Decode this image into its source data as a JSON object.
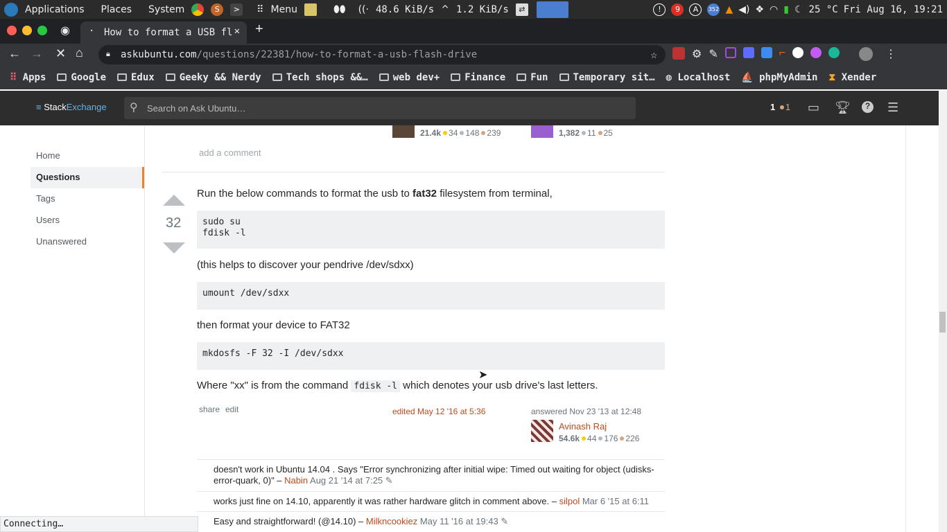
{
  "os_panel": {
    "menu_applications": "Applications",
    "menu_places": "Places",
    "menu_system": "System",
    "menu_menu": "Menu",
    "net_down": "48.6 KiB/s",
    "net_up": "1.2 KiB/s",
    "badge_9": "9",
    "badge_a": "A",
    "badge_352": "352",
    "temperature": "25 °C",
    "datetime": "Fri Aug 16, 19:21"
  },
  "browser": {
    "tab_title": "How to format a USB fl",
    "url_domain": "askubuntu.com",
    "url_path": "/questions/22381/how-to-format-a-usb-flash-drive",
    "bookmarks": [
      "Apps",
      "Google",
      "Edux",
      "Geeky && Nerdy",
      "Tech shops &&…",
      "web dev+",
      "Finance",
      "Fun",
      "Temporary sit…",
      "Localhost",
      "phpMyAdmin",
      "Xender"
    ],
    "status_text": "Connecting…"
  },
  "stackexchange": {
    "brand_stack": "Stack",
    "brand_exchange": "Exchange",
    "search_placeholder": "Search on Ask Ubuntu…",
    "rep": "1",
    "bronze_count": "1"
  },
  "left_nav": {
    "items": [
      "Home",
      "Questions",
      "Tags",
      "Users",
      "Unanswered"
    ]
  },
  "top_user_cards": {
    "card1": {
      "rep": "21.4k",
      "gold": "34",
      "silver": "148",
      "bronze": "239"
    },
    "card2": {
      "rep": "1,382",
      "silver": "11",
      "bronze": "25"
    },
    "add_comment": "add a comment"
  },
  "answer": {
    "votes": "32",
    "p1_before": "Run the below commands to format the usb to ",
    "p1_bold": "fat32",
    "p1_after": " filesystem from terminal,",
    "code1": "sudo su\nfdisk -l",
    "p2": "(this helps to discover your pendrive /dev/sdxx)",
    "code2": "umount /dev/sdxx",
    "p3": "then format your device to FAT32",
    "code3": "mkdosfs -F 32 -I /dev/sdxx",
    "p4_before": "Where \"xx\" is from the command ",
    "p4_code": "fdisk -l",
    "p4_after": " which denotes your usb drive's last letters.",
    "share": "share",
    "edit": "edit",
    "edited": "edited May 12 '16 at 5:36",
    "answered": "answered Nov 23 '13 at 12:48",
    "author": "Avinash Raj",
    "author_rep": "54.6k",
    "author_gold": "44",
    "author_silver": "176",
    "author_bronze": "226"
  },
  "comments": [
    {
      "text": "doesn't work in Ubuntu 14.04 . Says \"Error synchronizing after initial wipe: Timed out waiting for object (udisks-error-quark, 0)\" – ",
      "user": "Nabin",
      "date": "Aug 21 '14 at 7:25"
    },
    {
      "text": "works just fine on 14.10, apparently it was rather hardware glitch in comment above. – ",
      "user": "silpol",
      "date": "Mar 6 '15 at 6:11"
    },
    {
      "text": "Easy and straightforward! (@14.10) – ",
      "user": "Milkncookiez",
      "date": "May 11 '16 at 19:43"
    }
  ],
  "colors": {
    "accent": "#f48024",
    "link": "#bb4a1d",
    "se_bar": "#2d2d2d"
  }
}
